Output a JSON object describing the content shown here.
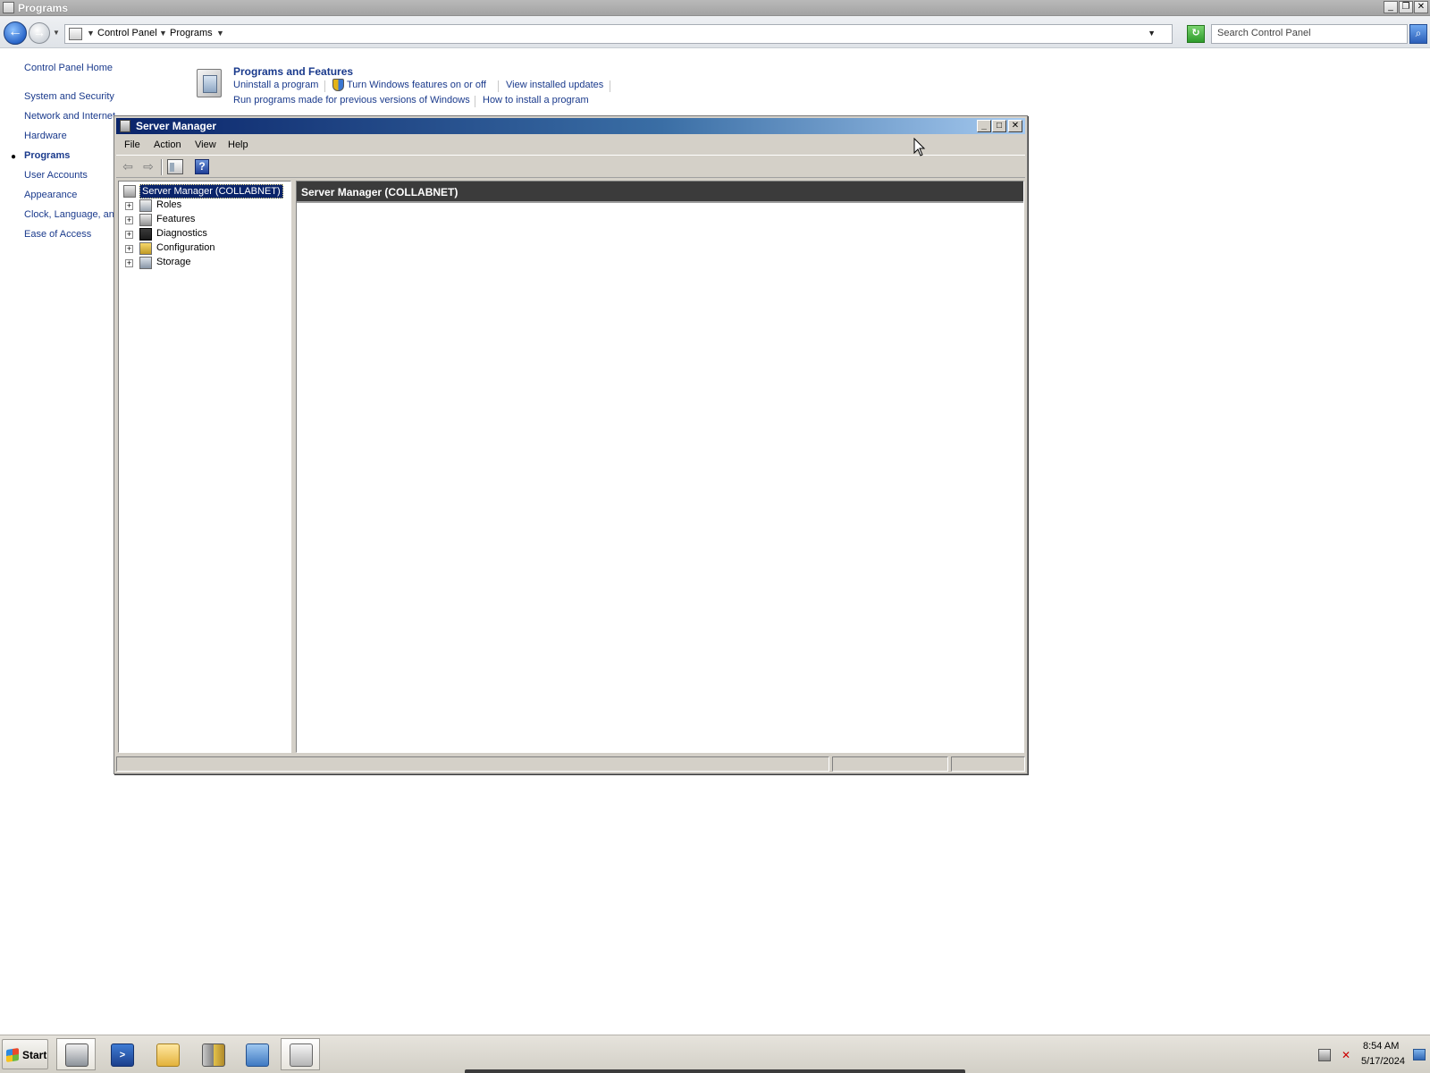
{
  "control_panel": {
    "window_title": "Programs",
    "breadcrumb": [
      "Control Panel",
      "Programs"
    ],
    "search_placeholder": "Search Control Panel",
    "nav": {
      "home": "Control Panel Home",
      "items": [
        "System and Security",
        "Network and Internet",
        "Hardware",
        "Programs",
        "User Accounts",
        "Appearance",
        "Clock, Language, and Region",
        "Ease of Access"
      ],
      "current": "Programs"
    },
    "programs_and_features": {
      "title": "Programs and Features",
      "links": [
        "Uninstall a program",
        "Turn Windows features on or off",
        "View installed updates",
        "Run programs made for previous versions of Windows",
        "How to install a program"
      ]
    }
  },
  "server_manager": {
    "window_title": "Server Manager",
    "menu": [
      "File",
      "Action",
      "View",
      "Help"
    ],
    "tree": {
      "root": "Server Manager (COLLABNET)",
      "children": [
        "Roles",
        "Features",
        "Diagnostics",
        "Configuration",
        "Storage"
      ]
    },
    "content_header": "Server Manager (COLLABNET)"
  },
  "taskbar": {
    "start_label": "Start",
    "apps": [
      "server-manager-icon",
      "powershell-icon",
      "explorer-icon",
      "tools-icon",
      "control-panel-icon",
      "programs-icon"
    ],
    "clock_time": "8:54 AM",
    "clock_date": "5/17/2024"
  }
}
